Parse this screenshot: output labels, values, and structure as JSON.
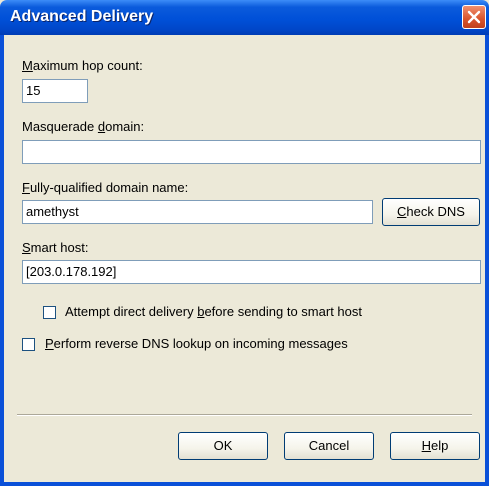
{
  "window": {
    "title": "Advanced Delivery"
  },
  "fields": {
    "max_hop": {
      "label_pre": "",
      "label_key": "M",
      "label_post": "aximum hop count:",
      "value": "15"
    },
    "masquerade": {
      "label_pre": "Masquerade ",
      "label_key": "d",
      "label_post": "omain:",
      "value": ""
    },
    "fqdn": {
      "label_pre": "",
      "label_key": "F",
      "label_post": "ully-qualified domain name:",
      "value": "amethyst"
    },
    "smart_host": {
      "label_pre": "",
      "label_key": "S",
      "label_post": "mart host:",
      "value": "[203.0.178.192]"
    }
  },
  "check_dns": {
    "pre": "",
    "key": "C",
    "post": "heck DNS"
  },
  "options": {
    "attempt_direct": {
      "pre": "Attempt direct delivery ",
      "key": "b",
      "post": "efore sending to smart host",
      "checked": false
    },
    "reverse_dns": {
      "pre": "",
      "key": "P",
      "post": "erform reverse DNS lookup on incoming messages",
      "checked": false
    }
  },
  "buttons": {
    "ok": {
      "pre": "",
      "key": "",
      "post": "OK"
    },
    "cancel": {
      "pre": "",
      "key": "",
      "post": "Cancel"
    },
    "help": {
      "pre": "",
      "key": "H",
      "post": "elp"
    }
  }
}
